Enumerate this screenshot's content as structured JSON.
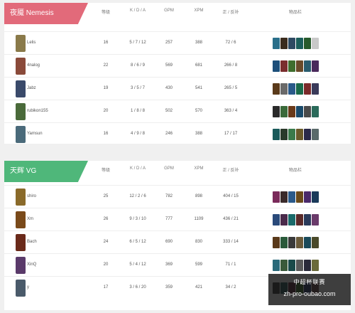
{
  "columns": [
    "等级",
    "K / D / A",
    "GPM",
    "XPM",
    "正 / 反补",
    "物品栏"
  ],
  "team_top": {
    "name": "夜魇 Nemesis",
    "accent": "#e26a7a",
    "players": [
      {
        "name": "Lelis",
        "level": "16",
        "kda": "5 / 7 / 12",
        "gpm": "257",
        "xpm": "388",
        "cs": "72 / 6",
        "avatar": "#8a7a4a",
        "items": [
          "#2a6f8a",
          "#3b2c1e",
          "#2e4a63",
          "#1c5e5b",
          "#275a2b",
          "#c9c9c9"
        ]
      },
      {
        "name": "4nalog",
        "level": "22",
        "kda": "8 / 6 / 9",
        "gpm": "569",
        "xpm": "681",
        "cs": "266 / 8",
        "avatar": "#8a4a3a",
        "items": [
          "#1d4f7a",
          "#7a2e2e",
          "#3f6e2e",
          "#6a4a2a",
          "#2a5c6e",
          "#4a2a5c"
        ]
      },
      {
        "name": "Jabz",
        "level": "19",
        "kda": "3 / 5 / 7",
        "gpm": "430",
        "xpm": "541",
        "cs": "265 / 5",
        "avatar": "#3a4a6a",
        "items": [
          "#5a3a1a",
          "#6a6a6a",
          "#2a5a8a",
          "#1a6a4a",
          "#7a2a2a",
          "#3a3a5a"
        ]
      },
      {
        "name": "rubikon155",
        "level": "20",
        "kda": "1 / 8 / 8",
        "gpm": "502",
        "xpm": "570",
        "cs": "363 / 4",
        "avatar": "#4a6a3a",
        "items": [
          "#2a2a2a",
          "#3a6a3a",
          "#6a3a1a",
          "#1a4a6a",
          "#4a4a4a",
          "#2a6a5a"
        ]
      },
      {
        "name": "Yamsun",
        "level": "16",
        "kda": "4 / 9 / 8",
        "gpm": "246",
        "xpm": "388",
        "cs": "17 / 17",
        "avatar": "#4a6a7a",
        "items": [
          "#1a5a5a",
          "#2a3a2a",
          "#3a7a4a",
          "#6a5a2a",
          "#2a2a4a",
          "#5a6a6a"
        ]
      }
    ]
  },
  "team_bottom": {
    "name": "天辉 VG",
    "accent": "#4fb77a",
    "players": [
      {
        "name": "shiro",
        "level": "25",
        "kda": "12 / 2 / 6",
        "gpm": "782",
        "xpm": "898",
        "cs": "404 / 15",
        "avatar": "#8a6a2a",
        "items": [
          "#7a2a5a",
          "#3a2a2a",
          "#2a5a8a",
          "#6a4a1a",
          "#4a2a6a",
          "#1a3a5a"
        ]
      },
      {
        "name": "Xm",
        "level": "26",
        "kda": "9 / 3 / 10",
        "gpm": "777",
        "xpm": "1109",
        "cs": "436 / 21",
        "avatar": "#7a4a1a",
        "items": [
          "#2a4a7a",
          "#4a2a4a",
          "#1a6a6a",
          "#5a2a2a",
          "#2a3a5a",
          "#6a3a6a"
        ]
      },
      {
        "name": "Bach",
        "level": "24",
        "kda": "6 / 5 / 12",
        "gpm": "690",
        "xpm": "830",
        "cs": "333 / 14",
        "avatar": "#6a2a1a",
        "items": [
          "#5a3a1a",
          "#2a5a3a",
          "#3a3a3a",
          "#6a5a3a",
          "#1a4a5a",
          "#4a4a2a"
        ]
      },
      {
        "name": "XinQ",
        "level": "20",
        "kda": "5 / 4 / 12",
        "gpm": "369",
        "xpm": "599",
        "cs": "71 / 1",
        "avatar": "#5a3a6a",
        "items": [
          "#2a6a7a",
          "#3a5a3a",
          "#1a4a4a",
          "#5a5a5a",
          "#2a2a3a",
          "#6a6a3a"
        ]
      },
      {
        "name": "y",
        "level": "17",
        "kda": "3 / 6 / 20",
        "gpm": "359",
        "xpm": "421",
        "cs": "34 / 2",
        "avatar": "#4a5a6a",
        "items": [
          "#3a3a3a",
          "#2a5a5a",
          "#5a2a3a",
          "#3a6a2a",
          "#2a3a6a",
          "#6a4a4a"
        ]
      }
    ]
  },
  "watermark": {
    "logo": "中超杯联赛",
    "url": "zh-pro-oubao.com"
  }
}
